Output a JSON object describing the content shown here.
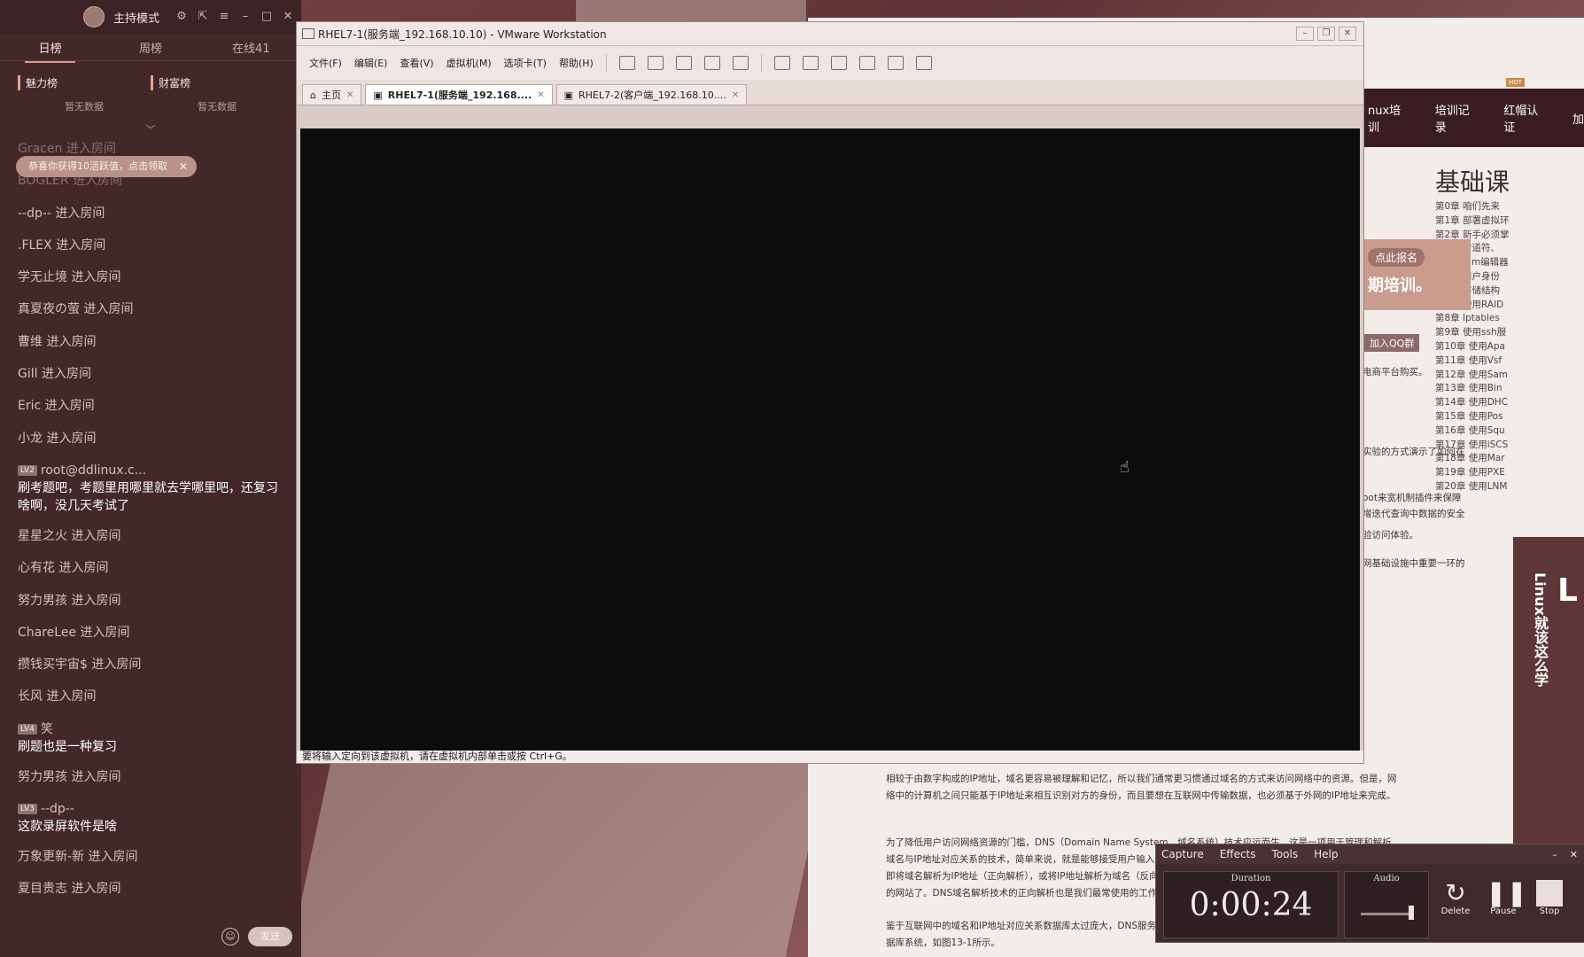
{
  "chat": {
    "mode_label": "主持模式",
    "tabs": [
      "日榜",
      "周榜",
      "在线41"
    ],
    "rank": [
      {
        "title": "魅力榜",
        "empty": "暂无数据"
      },
      {
        "title": "财富榜",
        "empty": "暂无数据"
      }
    ],
    "notice": "恭喜你获得10活跃值，点击领取",
    "messages": [
      {
        "kind": "enter",
        "user": "Gracen",
        "action": "进入房间",
        "faint": true
      },
      {
        "kind": "enter",
        "user": "BOGLER",
        "action": "进入房间",
        "faint": true
      },
      {
        "kind": "enter",
        "user": "--dp--",
        "action": "进入房间"
      },
      {
        "kind": "enter",
        "user": ".FLEX",
        "action": "进入房间"
      },
      {
        "kind": "enter",
        "user": "学无止境",
        "action": "进入房间"
      },
      {
        "kind": "enter",
        "user": "真夏夜の萤",
        "action": "进入房间"
      },
      {
        "kind": "enter",
        "user": "曹维",
        "action": "进入房间"
      },
      {
        "kind": "enter",
        "user": "Gill",
        "action": "进入房间"
      },
      {
        "kind": "enter",
        "user": "Eric",
        "action": "进入房间"
      },
      {
        "kind": "enter",
        "user": "小龙",
        "action": "进入房间"
      },
      {
        "kind": "chat",
        "level": "LV2",
        "user": "root@ddlinux.c...",
        "text": "刷考题吧，考题里用哪里就去学哪里吧，还复习啥啊，没几天考试了"
      },
      {
        "kind": "enter",
        "user": "星星之火",
        "action": "进入房间"
      },
      {
        "kind": "enter",
        "user": "心有花",
        "action": "进入房间"
      },
      {
        "kind": "enter",
        "user": "努力男孩",
        "action": "进入房间"
      },
      {
        "kind": "enter",
        "user": "ChareLee",
        "action": "进入房间"
      },
      {
        "kind": "enter",
        "user": "攒钱买宇宙$",
        "action": "进入房间"
      },
      {
        "kind": "enter",
        "user": "长风",
        "action": "进入房间"
      },
      {
        "kind": "chat",
        "level": "LV4",
        "user": "笑",
        "text": "刷题也是一种复习"
      },
      {
        "kind": "enter",
        "user": "努力男孩",
        "action": "进入房间"
      },
      {
        "kind": "chat",
        "level": "LV3",
        "user": "--dp--",
        "text": "这款录屏软件是啥"
      },
      {
        "kind": "enter",
        "user": "万象更新-新",
        "action": "进入房间"
      },
      {
        "kind": "enter",
        "user": "夏目贵志",
        "action": "进入房间"
      }
    ],
    "send_label": "发送"
  },
  "web": {
    "nav": [
      "nux培训",
      "培训记录",
      "红帽认证",
      "加"
    ],
    "nav_badge": "HOT",
    "heading": "基础课",
    "chapters": [
      "第0章 咱们先来",
      "第1章 部署虚拟环",
      "第2章 新手必须掌",
      "第3章 管道符、",
      "第4章 Vim编辑器",
      "第5章 用户身份",
      "第6章 存储结构",
      "第7章 使用RAID",
      "第8章 Iptables",
      "第9章 使用ssh服",
      "第10章 使用Apa",
      "第11章 使用Vsf",
      "第12章 使用Sam",
      "第13章 使用Bin",
      "第14章 使用DHC",
      "第15章 使用Pos",
      "第16章 使用Squ",
      "第17章 使用iSCS",
      "第18章 使用Mar",
      "第19章 使用PXE",
      "第20章 使用LNM"
    ],
    "banner_btn": "点此报名",
    "banner_text": "期培训。",
    "qq_label": "加入QQ群",
    "mall_line": "电商平台购买。",
    "side_lines": [
      "实验的方式演示了如何在",
      "oot来宽机制插件来保障",
      "增迭代查询中数据的安全",
      "验访问体验。",
      "网基础设施中重要一环的"
    ],
    "book_title": "Linux就该这么学",
    "book_big": "L",
    "paragraphs": [
      "相较于由数字构成的IP地址，域名更容易被理解和记忆，所以我们通常更习惯通过域名的方式来访问网络中的资源。但是，网络中的计算机之间只能基于IP地址来相互识别对方的身份，而且要想在互联网中传输数据，也必须基于外网的IP地址来完成。",
      "为了降低用户访问网络资源的门槛，DNS（Domain Name System，域名系统）技术应运而生。这是一项用于管理和解析域名与IP地址对应关系的技术，简单来说，就是能够接受用户输入的域名或IP地址，然后自动查找与之匹配的IP地址或域名，即将域名解析为IP地址（正向解析），或将IP地址解析为域名（反向解析）。这样一来，用户只需输入域名，即可打开想要访问的网站了。DNS域名解析技术的正向解析也是我们最常使用的工作模式。",
      "鉴于互联网中的域名和IP地址对应关系数据库太过庞大，DNS服务器不可能保存全部的对应关系，从而形成了一个分布式的数据库系统，如图13-1所示。"
    ]
  },
  "vmware": {
    "title": "RHEL7-1(服务端_192.168.10.10) - VMware Workstation",
    "menu": [
      "文件(F)",
      "编辑(E)",
      "查看(V)",
      "虚拟机(M)",
      "选项卡(T)",
      "帮助(H)"
    ],
    "tabs": [
      {
        "label": "主页",
        "active": false
      },
      {
        "label": "RHEL7-1(服务端_192.168....",
        "active": true
      },
      {
        "label": "RHEL7-2(客户端_192.168.10....",
        "active": false
      }
    ],
    "status": "要将输入定向到该虚拟机，请在虚拟机内部单击或按 Ctrl+G。"
  },
  "recorder": {
    "menu": [
      "Capture",
      "Effects",
      "Tools",
      "Help"
    ],
    "duration_label": "Duration",
    "duration": "0:00:24",
    "audio_label": "Audio",
    "audio_level": 0.95,
    "buttons": [
      "Delete",
      "Pause",
      "Stop"
    ]
  }
}
